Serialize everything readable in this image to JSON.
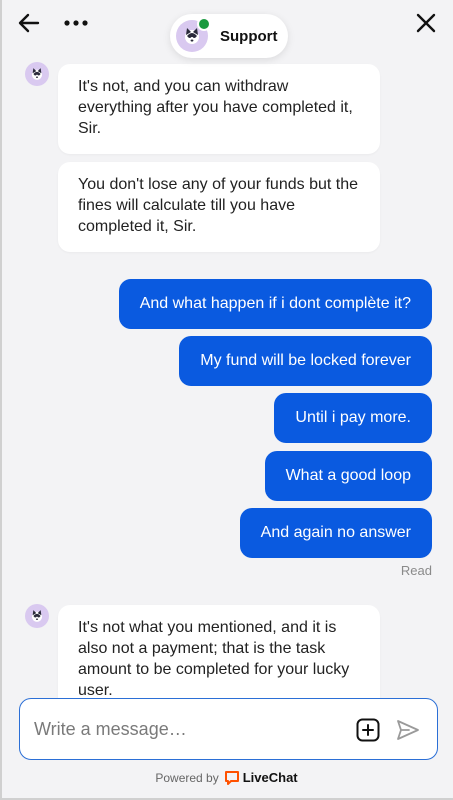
{
  "header": {
    "title": "Support",
    "icons": {
      "back": "arrow-left-icon",
      "more": "more-dots-icon",
      "close": "close-icon"
    }
  },
  "messages": [
    {
      "from": "agent",
      "text": "It's not, and you can withdraw everything after you have completed it, Sir."
    },
    {
      "from": "agent",
      "text": "You don't lose any of your funds but the fines will calculate till you have completed it, Sir."
    },
    {
      "from": "user",
      "text": "And what happen if i dont complète it?"
    },
    {
      "from": "user",
      "text": "My fund will be locked forever"
    },
    {
      "from": "user",
      "text": "Until i pay more."
    },
    {
      "from": "user",
      "text": "What a good loop"
    },
    {
      "from": "user",
      "text": "And again no answer"
    },
    {
      "from": "agent",
      "text": "It's not what you mentioned, and it is also not a payment; that is the task amount to be completed for your lucky user."
    }
  ],
  "read_status": "Read",
  "composer": {
    "placeholder": "Write a message…",
    "value": ""
  },
  "footer": {
    "powered_by": "Powered by",
    "brand": "LiveChat"
  },
  "colors": {
    "accent": "#0a5ae0",
    "online": "#1a9a3f",
    "brand_orange": "#ff5100"
  }
}
